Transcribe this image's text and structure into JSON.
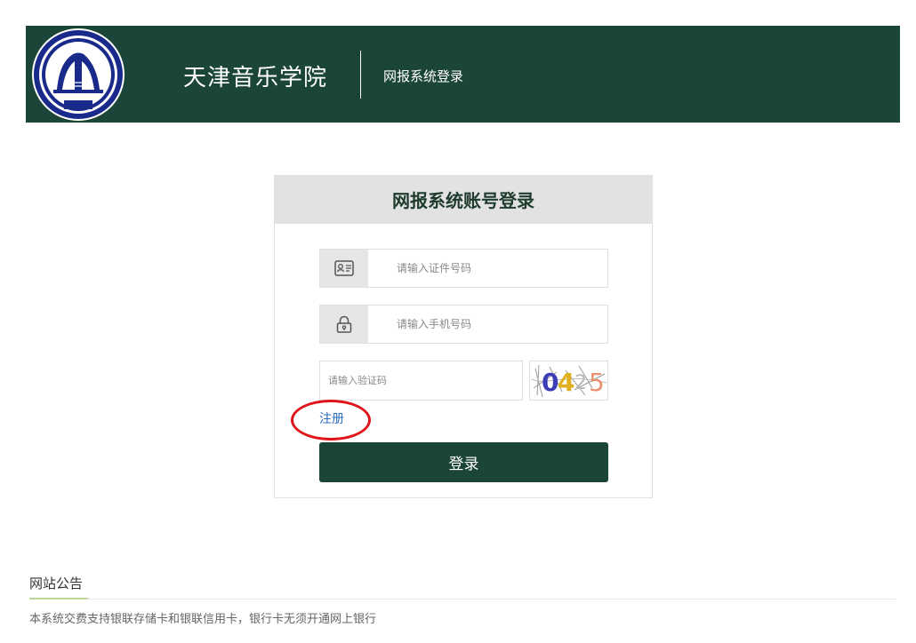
{
  "header": {
    "school_name": "天津音乐学院",
    "system_title": "网报系统登录",
    "seal_text": "1958.10.1",
    "bg_color": "#1b4538"
  },
  "login": {
    "title": "网报系统账号登录",
    "id_placeholder": "请输入证件号码",
    "phone_placeholder": "请输入手机号码",
    "captcha_placeholder": "请输入验证码",
    "captcha_text": "0425",
    "register_label": "注册",
    "submit_label": "登录",
    "icons": {
      "id_field": "id-card-icon",
      "phone_field": "lock-icon"
    }
  },
  "notice": {
    "title": "网站公告",
    "items": [
      "本系统交费支持银联存储卡和银联信用卡，银行卡无须开通网上银行"
    ]
  },
  "colors": {
    "primary": "#1b4538",
    "link": "#2a6cbf",
    "highlight_circle": "#e0141b"
  }
}
